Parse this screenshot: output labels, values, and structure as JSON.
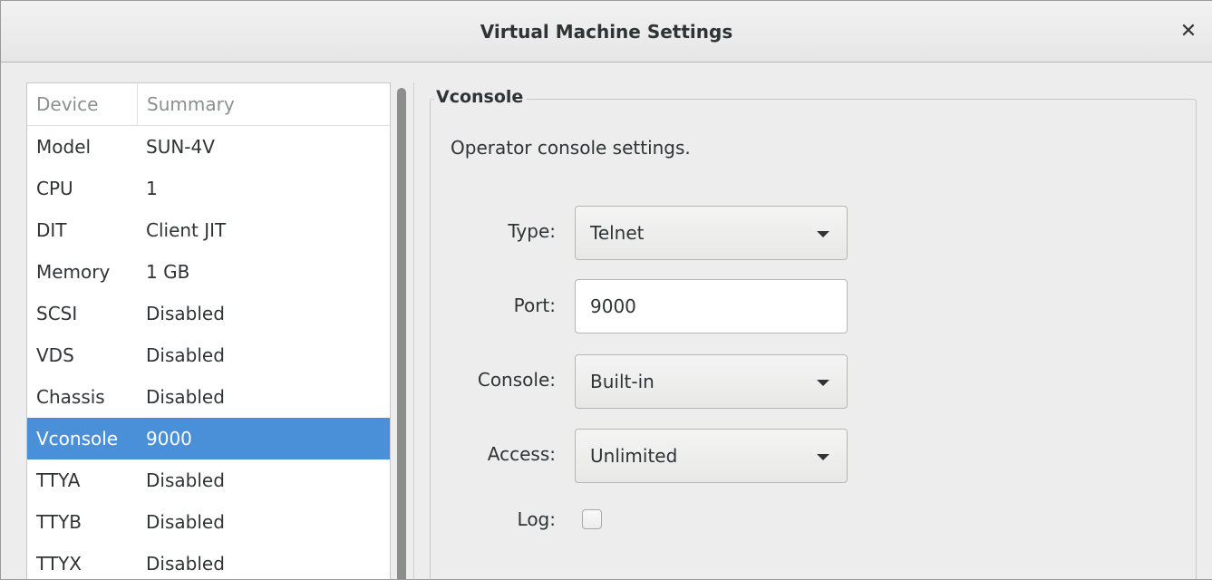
{
  "window": {
    "title": "Virtual Machine Settings",
    "close_glyph": "✕",
    "close_icon": "close-icon"
  },
  "device_list": {
    "headers": {
      "device": "Device",
      "summary": "Summary"
    },
    "rows": [
      {
        "device": "Model",
        "summary": "SUN-4V"
      },
      {
        "device": "CPU",
        "summary": "1"
      },
      {
        "device": "DIT",
        "summary": "Client JIT"
      },
      {
        "device": "Memory",
        "summary": "1 GB"
      },
      {
        "device": "SCSI",
        "summary": "Disabled"
      },
      {
        "device": "VDS",
        "summary": "Disabled"
      },
      {
        "device": "Chassis",
        "summary": "Disabled"
      },
      {
        "device": "Vconsole",
        "summary": "9000"
      },
      {
        "device": "TTYA",
        "summary": "Disabled"
      },
      {
        "device": "TTYB",
        "summary": "Disabled"
      },
      {
        "device": "TTYX",
        "summary": "Disabled"
      }
    ],
    "selected_device": "Vconsole"
  },
  "vconsole": {
    "frame_title": "Vconsole",
    "description": "Operator console settings.",
    "type": {
      "label": "Type:",
      "value": "Telnet"
    },
    "port": {
      "label": "Port:",
      "value": "9000"
    },
    "console": {
      "label": "Console:",
      "value": "Built-in"
    },
    "access": {
      "label": "Access:",
      "value": "Unlimited"
    },
    "log": {
      "label": "Log:",
      "checked": false
    }
  },
  "colors": {
    "selection": "#4a90d9",
    "window_bg": "#ededed",
    "text": "#2e3436"
  }
}
